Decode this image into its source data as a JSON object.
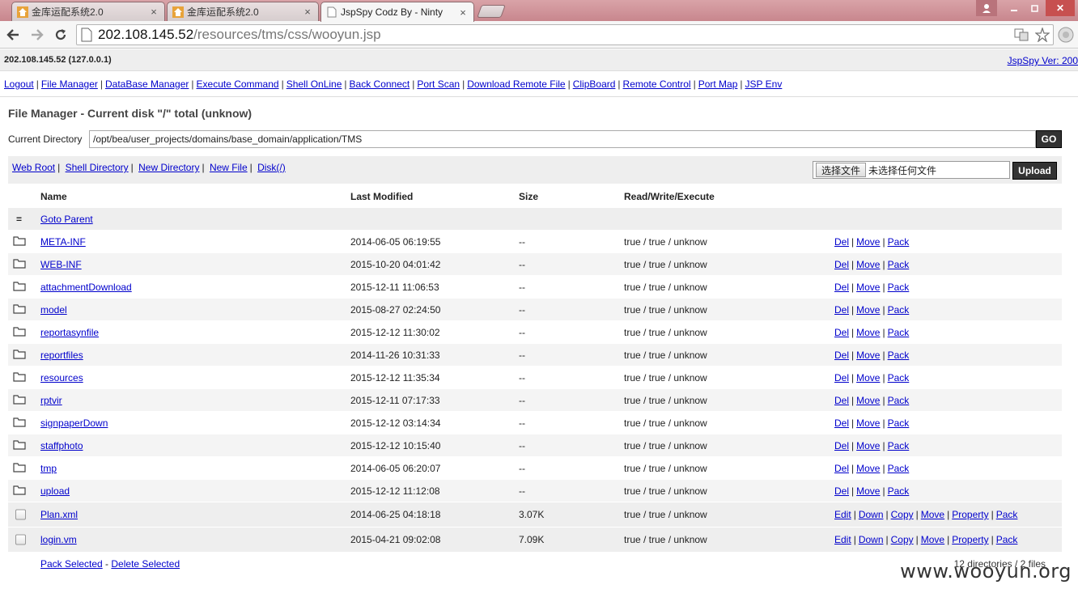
{
  "browser": {
    "tabs": [
      {
        "label": "金库运配系统2.0",
        "icon": "app-favicon"
      },
      {
        "label": "金库运配系统2.0",
        "icon": "app-favicon"
      },
      {
        "label": "JspSpy Codz By - Ninty",
        "icon": "page-icon",
        "active": true
      }
    ],
    "url_host": "202.108.145.52",
    "url_path": "/resources/tms/css/wooyun.jsp"
  },
  "header": {
    "host": "202.108.145.52 (127.0.0.1)",
    "version": "JspSpy Ver: 200"
  },
  "menu": [
    "Logout",
    "File Manager",
    "DataBase Manager",
    "Execute Command",
    "Shell OnLine",
    "Back Connect",
    "Port Scan",
    "Download Remote File",
    "ClipBoard",
    "Remote Control",
    "Port Map",
    "JSP Env"
  ],
  "file_manager": {
    "title": "File Manager - Current disk \"/\" total (unknow)",
    "dir_label": "Current Directory",
    "dir_value": "/opt/bea/user_projects/domains/base_domain/application/TMS",
    "go_label": "GO",
    "links": [
      "Web Root",
      "Shell Directory",
      "New Directory",
      "New File",
      "Disk(/)"
    ],
    "file_choose_label": "选择文件",
    "file_none_label": "未选择任何文件",
    "upload_label": "Upload"
  },
  "table": {
    "headers": {
      "name": "Name",
      "modified": "Last Modified",
      "size": "Size",
      "rwx": "Read/Write/Execute"
    },
    "parent_icon": "=",
    "parent_label": "Goto Parent",
    "dirs": [
      {
        "name": "META-INF",
        "modified": "2014-06-05 06:19:55",
        "size": "--",
        "rwx": "true / true / unknow"
      },
      {
        "name": "WEB-INF",
        "modified": "2015-10-20 04:01:42",
        "size": "--",
        "rwx": "true / true / unknow"
      },
      {
        "name": "attachmentDownload",
        "modified": "2015-12-11 11:06:53",
        "size": "--",
        "rwx": "true / true / unknow"
      },
      {
        "name": "model",
        "modified": "2015-08-27 02:24:50",
        "size": "--",
        "rwx": "true / true / unknow"
      },
      {
        "name": "reportasynfile",
        "modified": "2015-12-12 11:30:02",
        "size": "--",
        "rwx": "true / true / unknow"
      },
      {
        "name": "reportfiles",
        "modified": "2014-11-26 10:31:33",
        "size": "--",
        "rwx": "true / true / unknow"
      },
      {
        "name": "resources",
        "modified": "2015-12-12 11:35:34",
        "size": "--",
        "rwx": "true / true / unknow"
      },
      {
        "name": "rptvir",
        "modified": "2015-12-11 07:17:33",
        "size": "--",
        "rwx": "true / true / unknow"
      },
      {
        "name": "signpaperDown",
        "modified": "2015-12-12 03:14:34",
        "size": "--",
        "rwx": "true / true / unknow"
      },
      {
        "name": "staffphoto",
        "modified": "2015-12-12 10:15:40",
        "size": "--",
        "rwx": "true / true / unknow"
      },
      {
        "name": "tmp",
        "modified": "2014-06-05 06:20:07",
        "size": "--",
        "rwx": "true / true / unknow"
      },
      {
        "name": "upload",
        "modified": "2015-12-12 11:12:08",
        "size": "--",
        "rwx": "true / true / unknow"
      }
    ],
    "dir_actions": [
      "Del",
      "Move",
      "Pack"
    ],
    "files": [
      {
        "name": "Plan.xml",
        "modified": "2014-06-25 04:18:18",
        "size": "3.07K",
        "rwx": "true / true / unknow"
      },
      {
        "name": "login.vm",
        "modified": "2015-04-21 09:02:08",
        "size": "7.09K",
        "rwx": "true / true / unknow"
      }
    ],
    "file_actions": [
      "Edit",
      "Down",
      "Copy",
      "Move",
      "Property",
      "Pack"
    ],
    "pack_selected": "Pack Selected",
    "delete_selected": "Delete Selected",
    "summary": "12 directories / 2 files"
  },
  "watermark": "www.wooyun.org"
}
